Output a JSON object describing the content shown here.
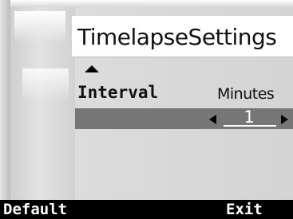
{
  "screen": {
    "title": "TimelapseSettings"
  },
  "setting": {
    "label": "Interval",
    "unit": "Minutes",
    "value": "1"
  },
  "softkeys": {
    "left": "Default",
    "right": "Exit"
  },
  "icons": {
    "scroll_up": "triangle-up-icon",
    "decrement": "triangle-left-icon",
    "increment": "triangle-right-icon"
  },
  "colors": {
    "title_band": "#ffffff",
    "panel_bg": "#d6d6d6",
    "selected_row": "#767676",
    "softkey_bar": "#000000",
    "text_dark": "#111111",
    "text_light": "#ffffff"
  }
}
